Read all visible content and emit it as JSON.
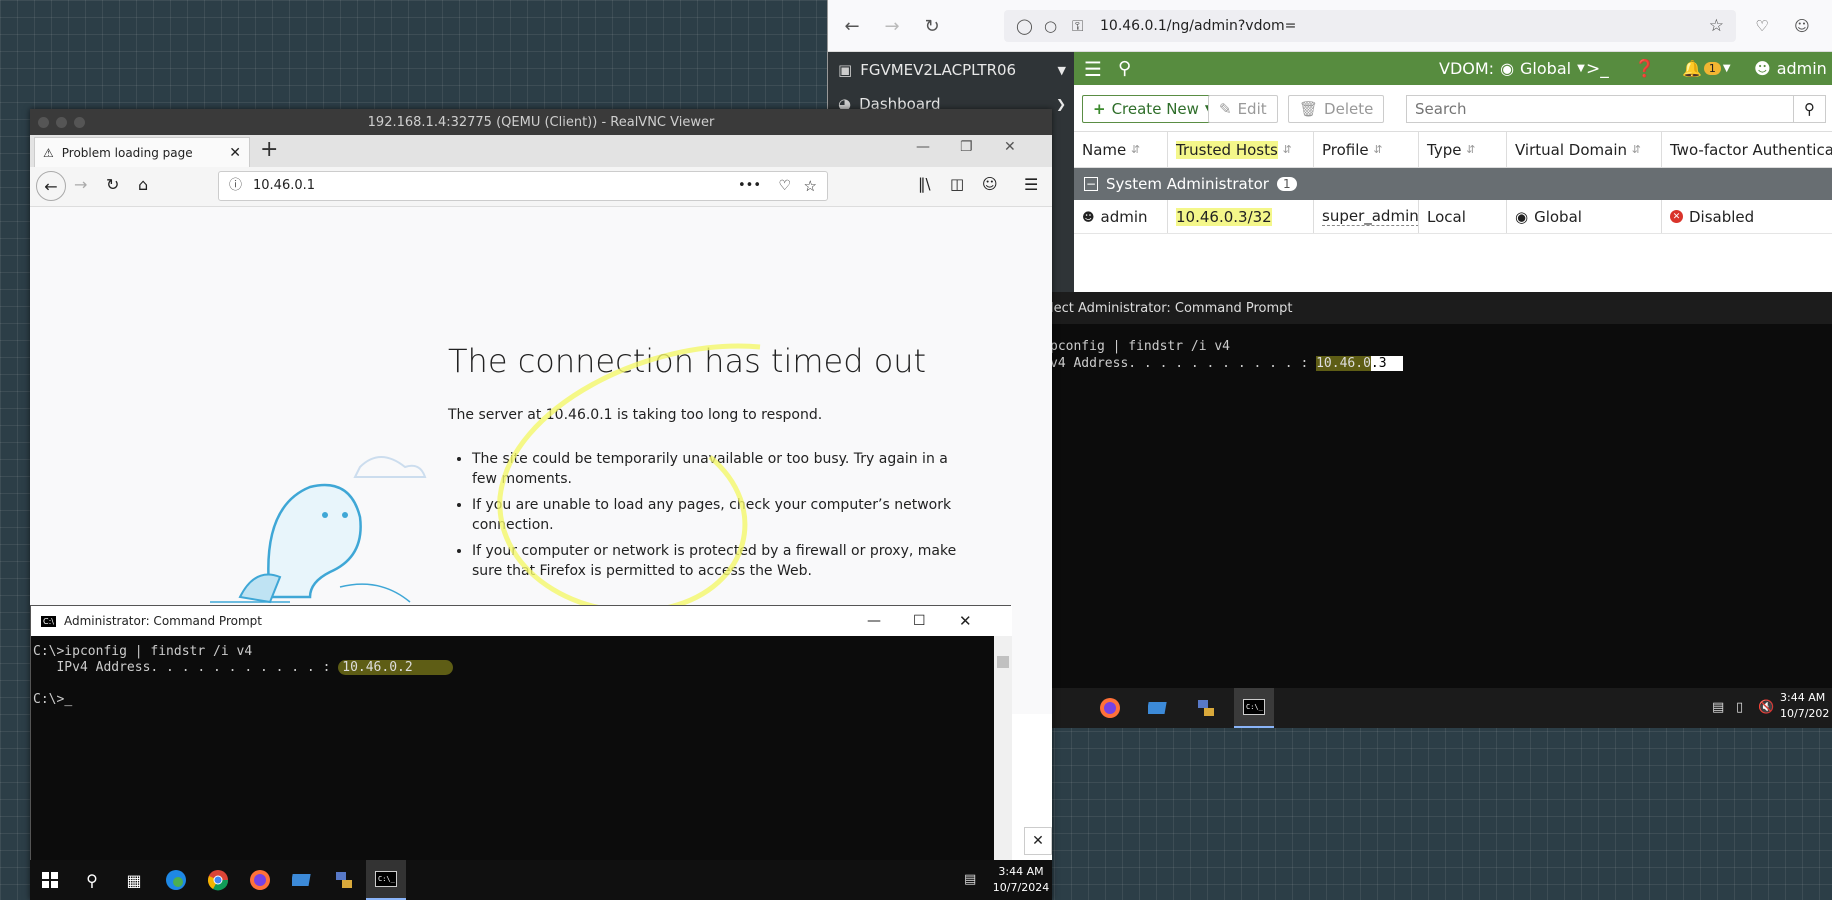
{
  "host_browser": {
    "url": "10.46.0.1/ng/admin?vdom="
  },
  "forti": {
    "device_name": "FGVMEV2LACPLTR06",
    "menu_dashboard": "Dashboard",
    "vdom_label": "VDOM:",
    "vdom_value": "Global",
    "notifications_count": "1",
    "user": "admin",
    "toolbar": {
      "create_new": "Create New",
      "edit": "Edit",
      "delete": "Delete",
      "search_placeholder": "Search"
    },
    "columns": [
      "Name",
      "Trusted Hosts",
      "Profile",
      "Type",
      "Virtual Domain",
      "Two-factor Authenticatio"
    ],
    "group": {
      "label": "System Administrator",
      "count": "1"
    },
    "row": {
      "name": "admin",
      "trusted_hosts": "10.46.0.3/32",
      "profile": "super_admin",
      "type": "Local",
      "virtual_domain": "Global",
      "two_factor": "Disabled"
    }
  },
  "vm_right": {
    "window_title": "lect Administrator: Command Prompt",
    "line1": "pconfig | findstr /i v4",
    "line2_prefix": "v4 Address. . . . . . . . . . . : ",
    "line2_ip_part1": "10.46.0",
    "line2_ip_part2": ".3",
    "clock_time": "3:44 AM",
    "clock_date": "10/7/202"
  },
  "vnc": {
    "window_title": "192.168.1.4:32775 (QEMU (Client)) - RealVNC Viewer",
    "tab_title": "Problem loading page",
    "url": "10.46.0.1",
    "error": {
      "title": "The connection has timed out",
      "message": "The server at 10.46.0.1 is taking too long to respond.",
      "bullets": [
        "The site could be temporarily unavailable or too busy. Try again in a few moments.",
        "If you are unable to load any pages, check your computer’s network connection.",
        "If your computer or network is protected by a firewall or proxy, make sure that Firefox is permitted to access the Web."
      ]
    },
    "cmd": {
      "title": "Administrator: Command Prompt",
      "line1": "C:\\>ipconfig | findstr /i v4",
      "line2_prefix": "   IPv4 Address. . . . . . . . . . . : ",
      "line2_ip": "10.46.0.2",
      "line3": "C:\\>"
    },
    "clock_time": "3:44 AM",
    "clock_date": "10/7/2024"
  },
  "colors": {
    "forti_green": "#578c3f",
    "highlight_yellow": "#f4f78a",
    "marker_olive": "#6b6b1e"
  }
}
